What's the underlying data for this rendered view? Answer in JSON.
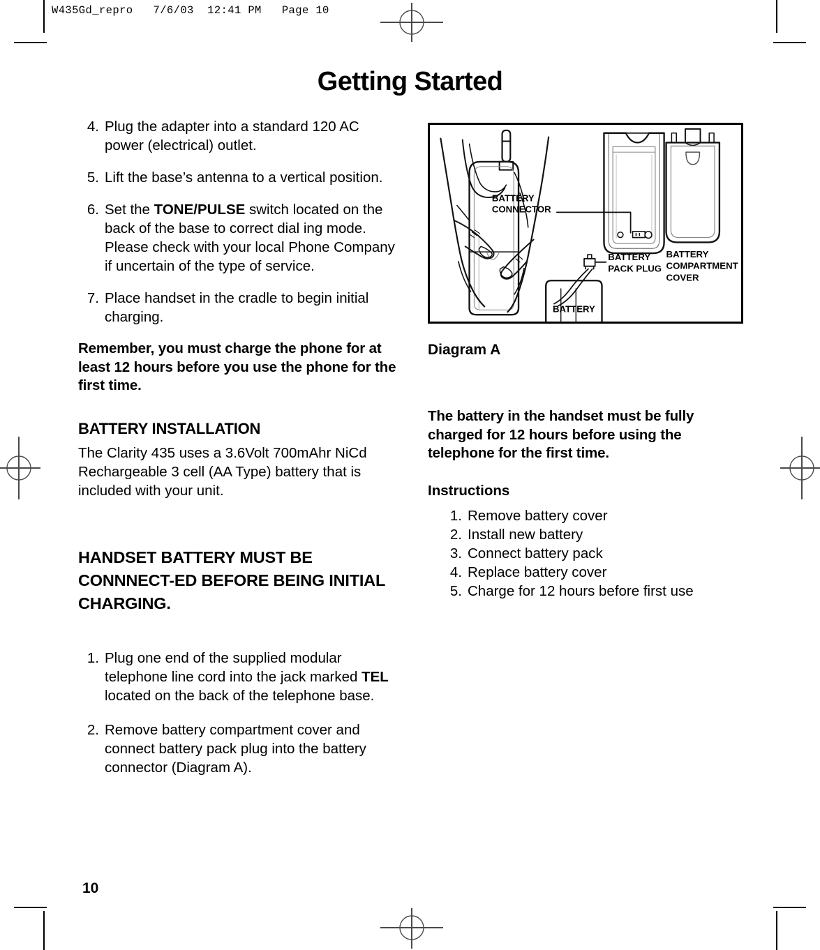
{
  "slug": {
    "text": "W435Gd_repro   7/6/03  12:41 PM   Page 10"
  },
  "title": "Getting Started",
  "left_column": {
    "steps_top": [
      {
        "num": "4.",
        "text": "Plug the adapter into a standard 120 AC power (electrical) outlet."
      },
      {
        "num": "5.",
        "text": "Lift the base’s antenna to a vertical position."
      },
      {
        "num": "6.",
        "pre": "Set the ",
        "bold": "TONE/PULSE",
        "post": " switch located on the back of the base to correct dial ing mode. Please check with your local Phone Company if uncertain of the type of service."
      },
      {
        "num": "7.",
        "text": "Place handset in the cradle to begin initial charging."
      }
    ],
    "remember_note": "Remember, you must charge the phone for at least 12 hours before you use the phone for the first time.",
    "battery_installation_heading": "BATTERY INSTALLATION",
    "battery_installation_body": "The Clarity 435 uses a 3.6Volt 700mAhr NiCd Rechargeable 3 cell (AA Type) battery that is included with your unit.",
    "handset_warning_heading": "HANDSET BATTERY MUST BE CONNNECT-ED BEFORE BEING INITIAL CHARGING.",
    "steps_bottom": [
      {
        "num": "1.",
        "pre": "Plug one end of the supplied modular telephone line cord into the jack marked ",
        "bold": "TEL",
        "post": " located on the back of the telephone base."
      },
      {
        "num": "2.",
        "text": "Remove battery compartment cover and connect battery pack plug into the battery connector (Diagram A)."
      }
    ]
  },
  "diagram": {
    "caption": "Diagram A",
    "labels": {
      "battery_connector": "BATTERY\nCONNECTOR",
      "battery_connector_line1": "BATTERY",
      "battery_connector_line2": "CONNECTOR",
      "battery_pack_plug_line1": "BATTERY",
      "battery_pack_plug_line2": "PACK PLUG",
      "battery_compartment_cover_line1": "BATTERY",
      "battery_compartment_cover_line2": "COMPARTMENT",
      "battery_compartment_cover_line3": "COVER",
      "battery": "BATTERY"
    }
  },
  "right_column": {
    "charge_note": "The battery in the handset must be fully charged for 12 hours before using the telephone for the first time.",
    "instructions_heading": "Instructions",
    "instructions": [
      {
        "num": "1.",
        "text": "Remove battery cover"
      },
      {
        "num": "2.",
        "text": "Install new battery"
      },
      {
        "num": "3.",
        "text": "Connect battery pack"
      },
      {
        "num": "4.",
        "text": "Replace battery cover"
      },
      {
        "num": "5.",
        "text": "Charge for 12 hours before first use"
      }
    ]
  },
  "folio": "10",
  "colors": {
    "ink": "#000000",
    "registration": "#4a4a4a",
    "paper": "#ffffff"
  }
}
